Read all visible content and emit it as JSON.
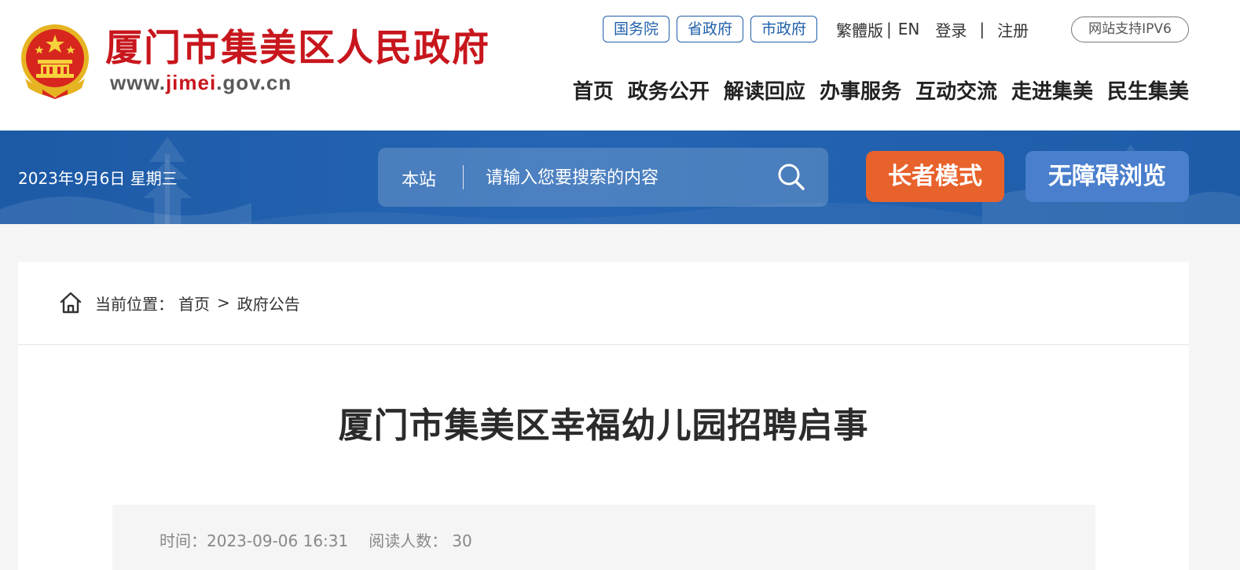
{
  "header": {
    "site_title": "厦门市集美区人民政府",
    "url_prefix": "www.",
    "url_highlight": "jimei",
    "url_suffix": ".gov.cn",
    "gov_links": [
      "国务院",
      "省政府",
      "市政府"
    ],
    "traditional": "繁體版",
    "english": "EN",
    "login": "登录",
    "register": "注册",
    "separator": "|",
    "ipv6": "网站支持IPV6",
    "nav": [
      "首页",
      "政务公开",
      "解读回应",
      "办事服务",
      "互动交流",
      "走进集美",
      "民生集美"
    ]
  },
  "banner": {
    "date": "2023年9月6日 星期三",
    "search_scope": "本站",
    "search_placeholder": "请输入您要搜索的内容",
    "elder_mode": "长者模式",
    "accessible": "无障碍浏览"
  },
  "breadcrumb": {
    "label": "当前位置：",
    "items": [
      "首页",
      "政府公告"
    ],
    "separator": ">"
  },
  "article": {
    "title": "厦门市集美区幸福幼儿园招聘启事",
    "time_label": "时间：",
    "time_value": "2023-09-06 16:31",
    "views_label": "阅读人数：",
    "views_value": "30"
  },
  "colors": {
    "brand_red": "#c8161d",
    "gov_blue": "#1f5fa9",
    "banner_blue": "#1d5aa6",
    "elder_orange": "#e8622b",
    "access_blue": "#4a7fcd"
  },
  "icons": [
    "national-emblem-icon",
    "search-icon",
    "home-icon"
  ]
}
